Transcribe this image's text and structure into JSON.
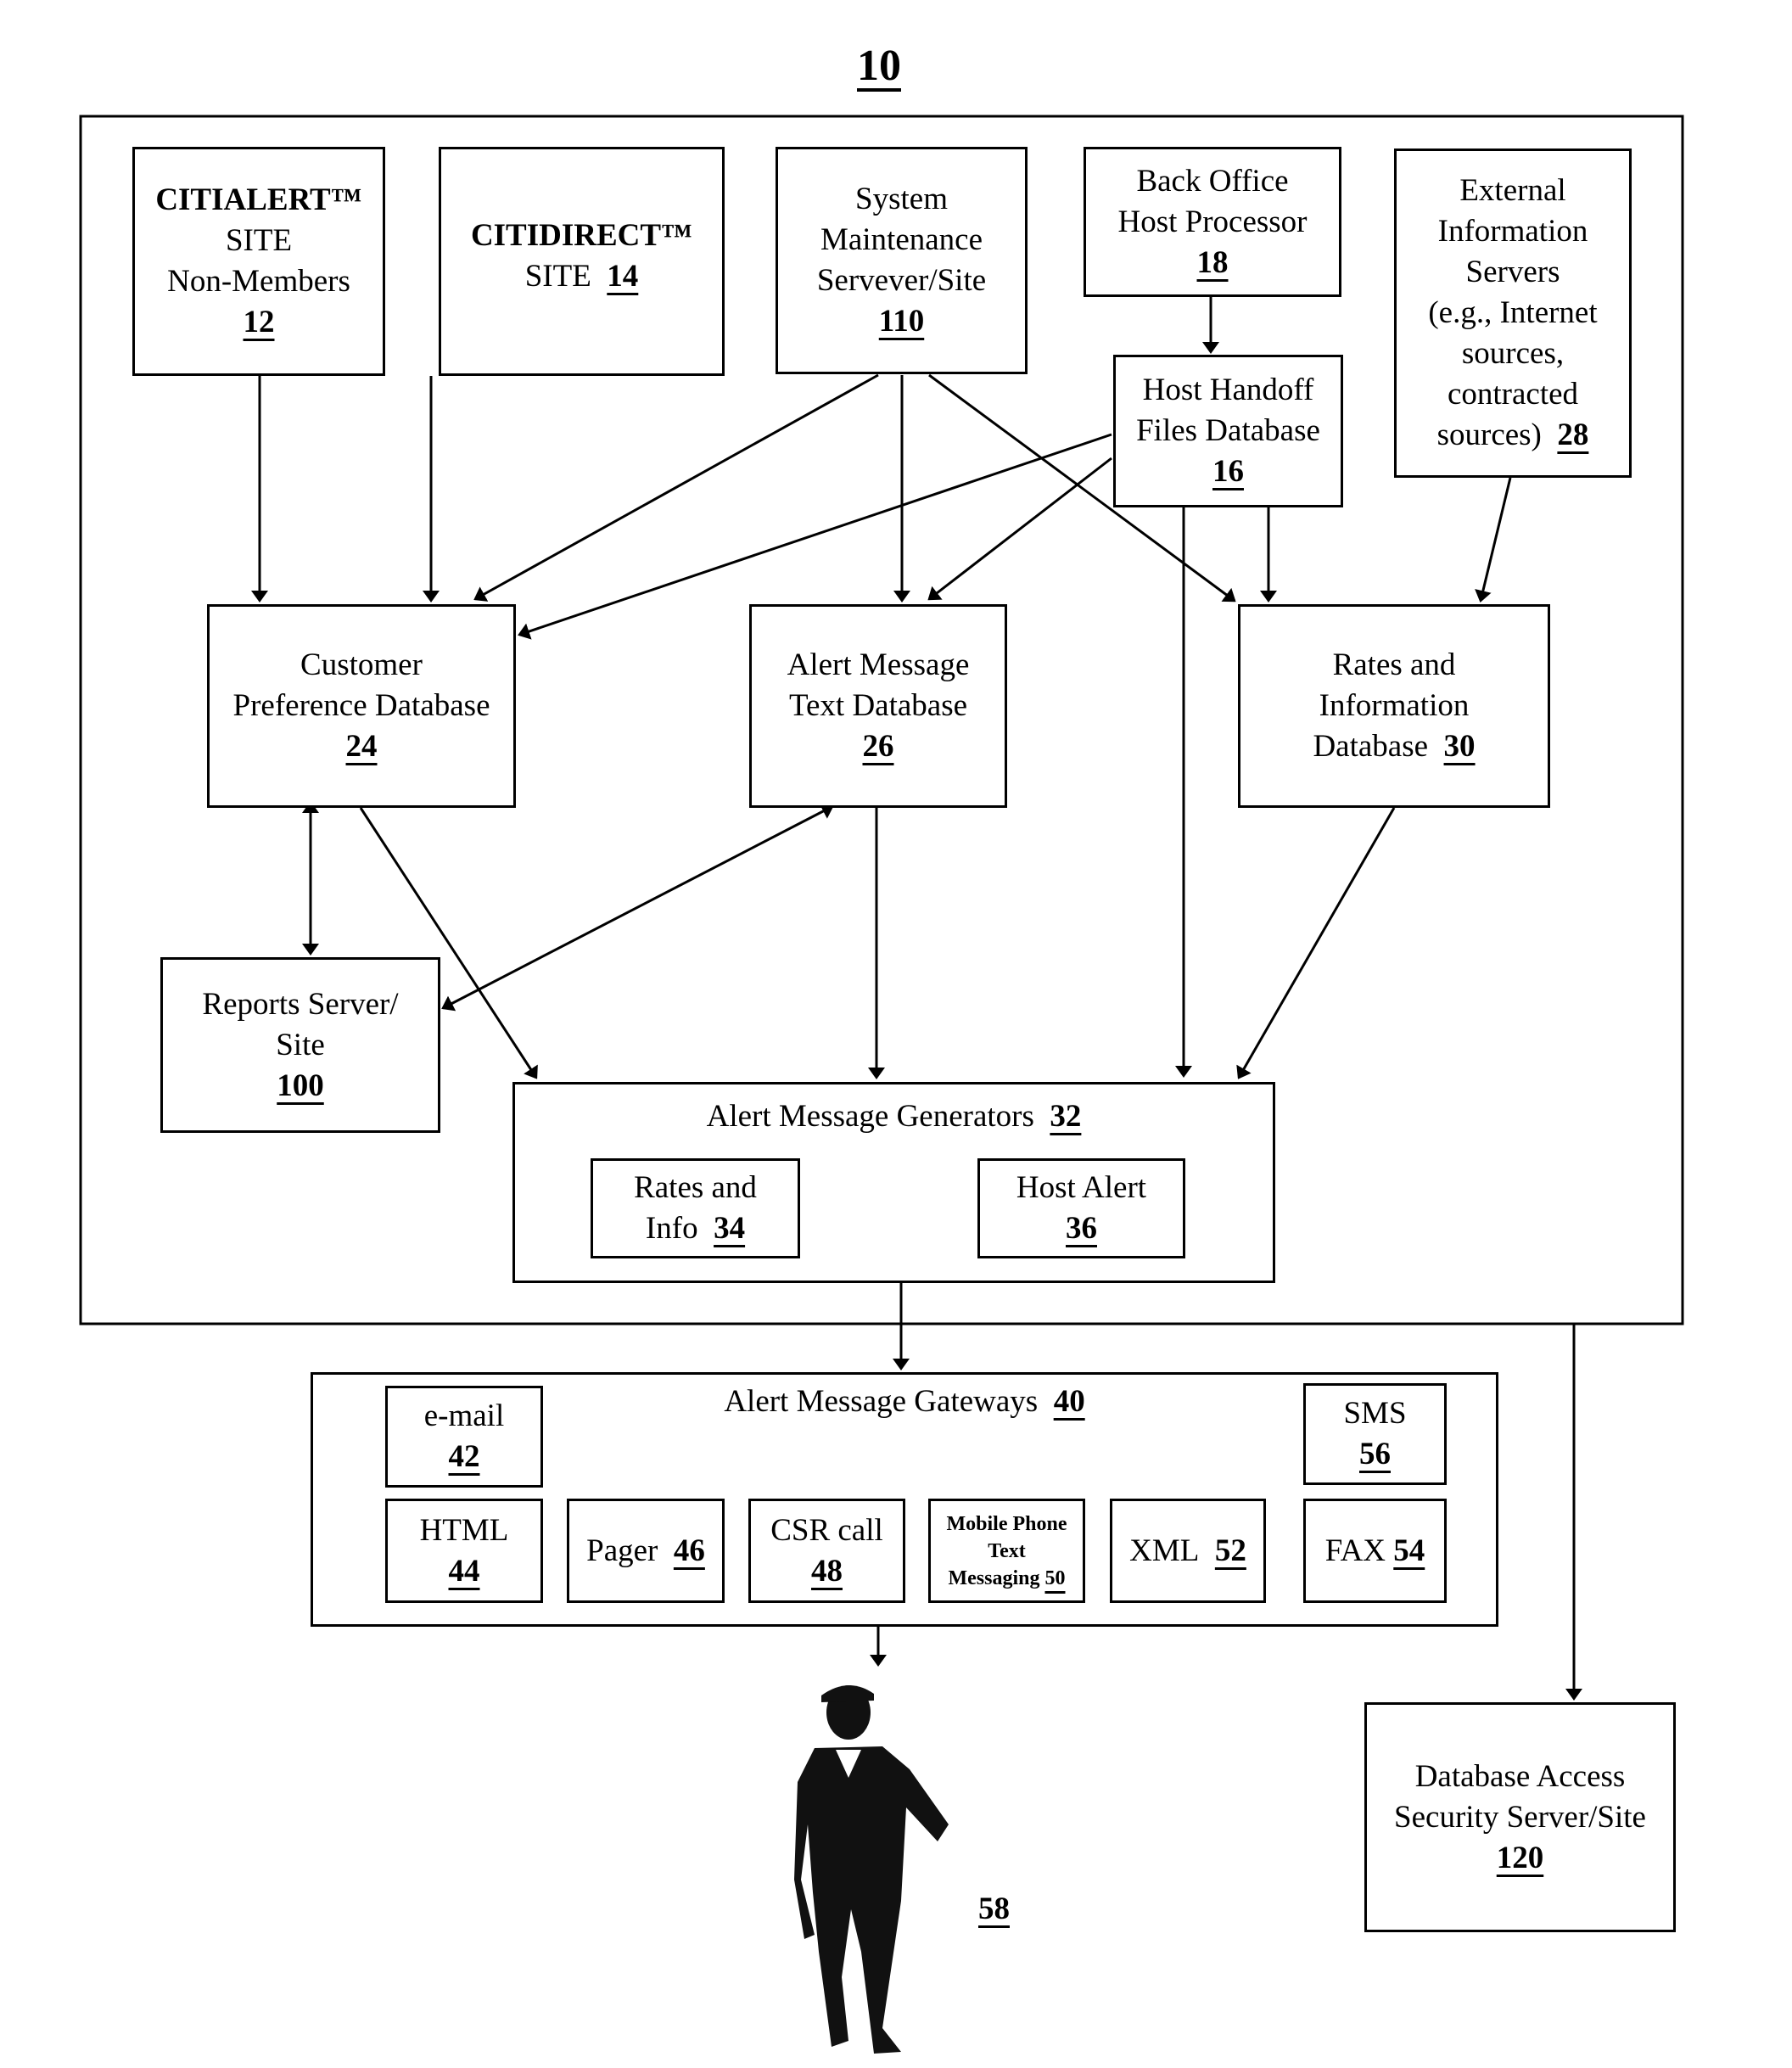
{
  "figure": {
    "reference_number": "10",
    "person_label": "58"
  },
  "boxes": {
    "citialert": {
      "lines": [
        "CITIALERT™",
        "SITE",
        "Non-Members"
      ],
      "num": "12"
    },
    "citidirect": {
      "lines": [
        "CITIDIRECT™",
        "SITE"
      ],
      "num": "14"
    },
    "system_maintenance": {
      "lines": [
        "System",
        "Maintenance",
        "Servever/Site"
      ],
      "num": "110"
    },
    "back_office": {
      "lines": [
        "Back Office",
        "Host Processor"
      ],
      "num": "18"
    },
    "host_handoff": {
      "lines": [
        "Host Handoff",
        "Files Database"
      ],
      "num": "16"
    },
    "external_info": {
      "lines": [
        "External",
        "Information",
        "Servers",
        "(e.g., Internet",
        "sources,",
        "contracted",
        "sources)"
      ],
      "num": "28"
    },
    "customer_pref": {
      "lines": [
        "Customer",
        "Preference Database"
      ],
      "num": "24"
    },
    "alert_msg_text": {
      "lines": [
        "Alert Message",
        "Text Database"
      ],
      "num": "26"
    },
    "rates_info_db": {
      "lines": [
        "Rates and",
        "Information",
        "Database"
      ],
      "num": "30"
    },
    "reports_server": {
      "lines": [
        "Reports Server/",
        "Site"
      ],
      "num": "100"
    },
    "generators": {
      "title": "Alert Message Generators",
      "num": "32"
    },
    "gen_rates_info": {
      "lines": [
        "Rates and",
        "Info"
      ],
      "num": "34"
    },
    "gen_host_alert": {
      "lines": [
        "Host Alert"
      ],
      "num": "36"
    },
    "gateways": {
      "title": "Alert Message Gateways",
      "num": "40"
    },
    "gw_email": {
      "lines": [
        "e-mail"
      ],
      "num": "42"
    },
    "gw_html": {
      "lines": [
        "HTML"
      ],
      "num": "44"
    },
    "gw_pager": {
      "lines": [
        "Pager"
      ],
      "num": "46"
    },
    "gw_csr": {
      "lines": [
        "CSR call"
      ],
      "num": "48"
    },
    "gw_mobile": {
      "lines": [
        "Mobile Phone",
        "Text",
        "Messaging"
      ],
      "num": "50"
    },
    "gw_xml": {
      "lines": [
        "XML"
      ],
      "num": "52"
    },
    "gw_fax": {
      "lines": [
        "FAX"
      ],
      "num": "54"
    },
    "gw_sms": {
      "lines": [
        "SMS"
      ],
      "num": "56"
    },
    "db_access": {
      "lines": [
        "Database Access",
        "Security Server/Site"
      ],
      "num": "120"
    }
  }
}
